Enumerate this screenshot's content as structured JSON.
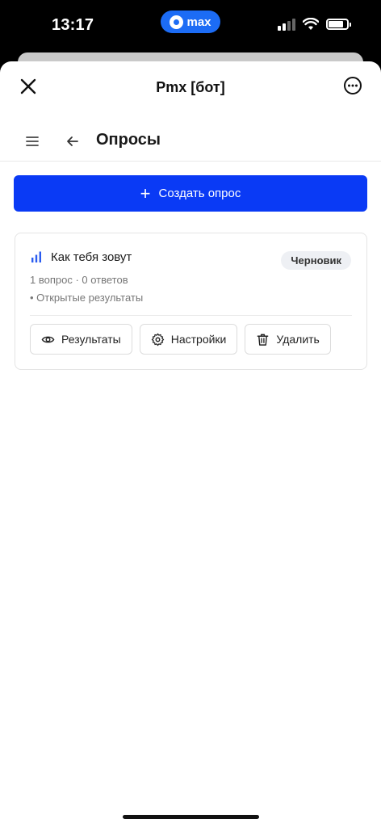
{
  "status_bar": {
    "time": "13:17",
    "app_pill_label": "max",
    "icons": [
      "signal-icon",
      "wifi-icon",
      "battery-icon"
    ]
  },
  "sheet": {
    "title": "Pmx [бот]",
    "close_icon": "close-icon",
    "more_icon": "more-icon"
  },
  "nav": {
    "menu_icon": "menu-icon",
    "back_icon": "back-arrow-icon",
    "page_title": "Опросы"
  },
  "create_button": {
    "label": "Создать опрос",
    "color": "#0a3af5"
  },
  "poll_card": {
    "title": "Как тебя зовут",
    "status_badge": "Черновик",
    "meta": "1 вопрос · 0 ответов",
    "note": "• Открытые результаты",
    "actions": [
      {
        "label": "Результаты",
        "icon": "eye-icon"
      },
      {
        "label": "Настройки",
        "icon": "gear-icon"
      },
      {
        "label": "Удалить",
        "icon": "trash-icon"
      }
    ]
  },
  "colors": {
    "accent": "#0a3af5",
    "chart_icon": "#2a5cf0"
  }
}
